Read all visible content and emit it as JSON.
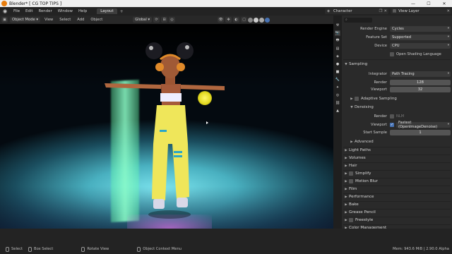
{
  "window": {
    "title": "Blender* [ CG TOP TIPS ]",
    "minimize": "—",
    "maximize": "☐",
    "close": "✕"
  },
  "menubar": {
    "items": [
      "File",
      "Edit",
      "Render",
      "Window",
      "Help"
    ],
    "active_tab": "Layout",
    "add_tab": "+",
    "scene": "Character",
    "view_layer": "View Layer"
  },
  "viewport_header": {
    "mode": "Object Mode",
    "menus": [
      "View",
      "Select",
      "Add",
      "Object"
    ],
    "orientation": "Global"
  },
  "properties": {
    "render_engine_label": "Render Engine",
    "render_engine": "Cycles",
    "feature_set_label": "Feature Set",
    "feature_set": "Supported",
    "device_label": "Device",
    "device": "CPU",
    "open_shading": "Open Shading Language",
    "sampling": "Sampling",
    "integrator_label": "Integrator",
    "integrator": "Path Tracing",
    "render_label": "Render",
    "render_samples": "128",
    "viewport_label": "Viewport",
    "viewport_samples": "32",
    "adaptive_sampling": "Adaptive Sampling",
    "denoising": "Denoising",
    "den_render_label": "Render",
    "den_render_value": "NLM",
    "den_viewport_label": "Viewport",
    "den_viewport_value": "Fastest (OpenImageDenoise)",
    "start_sample_label": "Start Sample",
    "start_sample": "1",
    "advanced": "Advanced",
    "panels": [
      "Light Paths",
      "Volumes",
      "Hair",
      "Simplify",
      "Motion Blur",
      "Film",
      "Performance",
      "Bake",
      "Grease Pencil",
      "Freestyle",
      "Color Management"
    ]
  },
  "statusbar": {
    "select": "Select",
    "box_select": "Box Select",
    "rotate_view": "Rotate View",
    "context_menu": "Object Context Menu",
    "memory": "Mem: 943.6 MiB | 2.90.0 Alpha"
  },
  "colors": {
    "accent": "#4772b3",
    "blender_orange": "#e87d0d",
    "character_pants": "#efe65a",
    "light_green": "#8effc6",
    "light_yellow": "#e2d91e"
  }
}
